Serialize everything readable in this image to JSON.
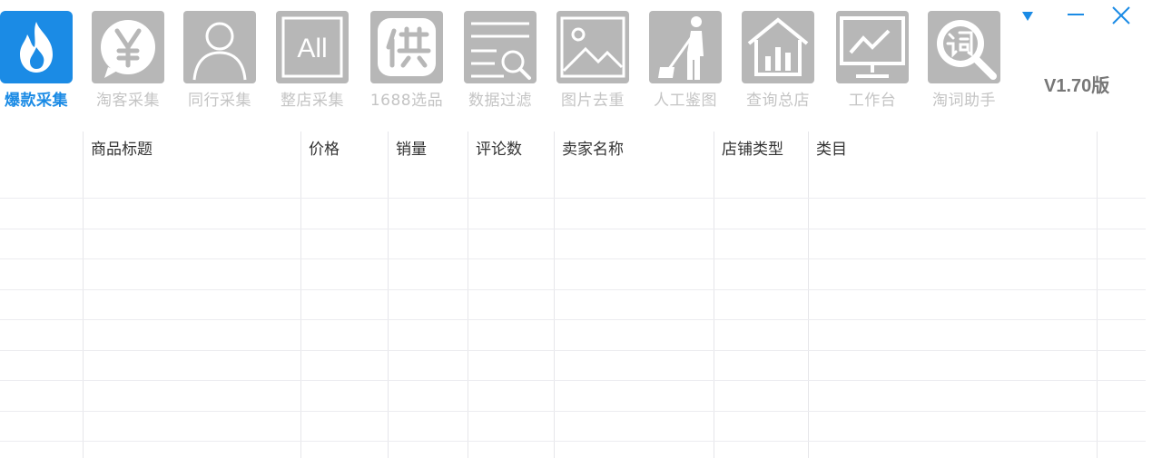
{
  "toolbar": {
    "tools": [
      {
        "label": "爆款采集",
        "icon": "flame-icon",
        "active": true
      },
      {
        "label": "淘客采集",
        "icon": "yen-chat-icon"
      },
      {
        "label": "同行采集",
        "icon": "person-icon"
      },
      {
        "label": "整店采集",
        "icon": "all-box-icon"
      },
      {
        "label": "1688选品",
        "icon": "supply-icon"
      },
      {
        "label": "数据过滤",
        "icon": "filter-search-icon"
      },
      {
        "label": "图片去重",
        "icon": "image-icon"
      },
      {
        "label": "人工鉴图",
        "icon": "sweeper-icon"
      },
      {
        "label": "查询总店",
        "icon": "store-chart-icon"
      },
      {
        "label": "工作台",
        "icon": "monitor-chart-icon"
      },
      {
        "label": "淘词助手",
        "icon": "word-search-icon"
      }
    ],
    "version": "V1.70版"
  },
  "window_controls": {
    "dropdown": "dropdown-triangle-icon",
    "minimize": "minimize-icon",
    "close": "close-icon"
  },
  "colors": {
    "active_icon_bg": "#1b8be5",
    "inactive_icon_bg": "#b7b7b7",
    "active_label": "#1b8be5",
    "inactive_label": "#c4c4c4"
  },
  "table": {
    "columns": [
      "",
      "商品标题",
      "价格",
      "销量",
      "评论数",
      "卖家名称",
      "店铺类型",
      "类目",
      ""
    ],
    "rows": []
  }
}
